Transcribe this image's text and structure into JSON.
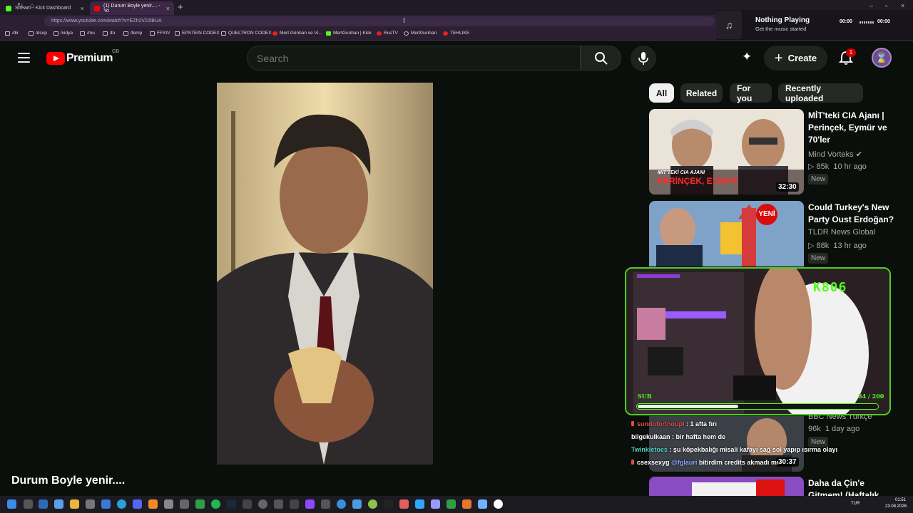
{
  "browser": {
    "tabs": [
      {
        "label": "Stream - Kick Dashboard",
        "favicon_color": "#53fc18"
      },
      {
        "label": "(1) Durum Boyle yenir.... - Yo",
        "favicon_color": "#ff0000"
      }
    ],
    "url": "https://www.youtube.com/watch?v=EZh2V22lBUA",
    "bookmarks": [
      {
        "label": "/dir"
      },
      {
        "label": "/dsop"
      },
      {
        "label": "/vidya"
      },
      {
        "label": "/mu"
      },
      {
        "label": "/to"
      },
      {
        "label": "/temp"
      },
      {
        "label": "FFXIV"
      },
      {
        "label": "EPSTEIN CODEX"
      },
      {
        "label": "QUELTRON CODEX"
      },
      {
        "label": "Mert Günhan ve Vi..."
      },
      {
        "label": "MertGunhan | Kick"
      },
      {
        "label": "RusTV"
      },
      {
        "label": "MertGunhan"
      },
      {
        "label": "TEHLIKE"
      }
    ]
  },
  "music_widget": {
    "title": "Nothing Playing",
    "subtitle": "Get the music started",
    "time_current": "00:00",
    "time_total": "00:00"
  },
  "youtube": {
    "brand": "Premium",
    "region": "GB",
    "search_placeholder": "Search",
    "create_label": "Create",
    "notification_count": "1",
    "video_title": "Durum Boyle yenir....",
    "chips": [
      "All",
      "Related",
      "For you",
      "Recently uploaded"
    ],
    "related": [
      {
        "title": "MİT'teki CIA Ajanı | Perinçek, Eymür ve 70'ler",
        "channel": "Mind Vorteks",
        "views": "85k",
        "age": "10 hr ago",
        "badge": "New",
        "duration": "32:30",
        "thumb_caption": "MİT'TEKİ CIA AJANI",
        "thumb_caption2": "PERİNÇEK, EYMÜR"
      },
      {
        "title": "Could Turkey's New Party Oust Erdoğan?",
        "channel": "TLDR News Global",
        "views": "88k",
        "age": "13 hr ago",
        "badge": "New",
        "thumb_caption": "YENİ"
      },
      {
        "channel": "BBC News Türkçe",
        "views": "96k",
        "age": "1 day ago",
        "badge": "New",
        "duration": "30:37"
      },
      {
        "title": "Daha da Çin'e Gitmem! (Haftalık Vlog)"
      }
    ]
  },
  "stream_overlay": {
    "title": "K806",
    "sub_label": "SUB",
    "sub_count": "84 / 200",
    "sub_progress": 0.42,
    "chat": [
      {
        "user": "sundofortnoupl",
        "message": "1 afta fırı",
        "user_color": "#e24b4b",
        "has_badge": true
      },
      {
        "user": "bilgekulkaan",
        "message": "bir hafta hem de",
        "user_color": "#ffffff",
        "has_badge": false
      },
      {
        "user": "Twinkletoes",
        "message": "şu köpekbalığı misali kafayı sağ sol yapıp ısırma olayı",
        "user_color": "#4fd1c5",
        "has_badge": false
      },
      {
        "user": "csexsexyg",
        "message": "bitirdim credits akmadı mı",
        "user_color": "#ffffff",
        "has_badge": true,
        "mention": "@fglauri"
      }
    ]
  },
  "taskbar": {
    "time": "01:51",
    "date": "23.08.2026",
    "lang": "TUR"
  }
}
